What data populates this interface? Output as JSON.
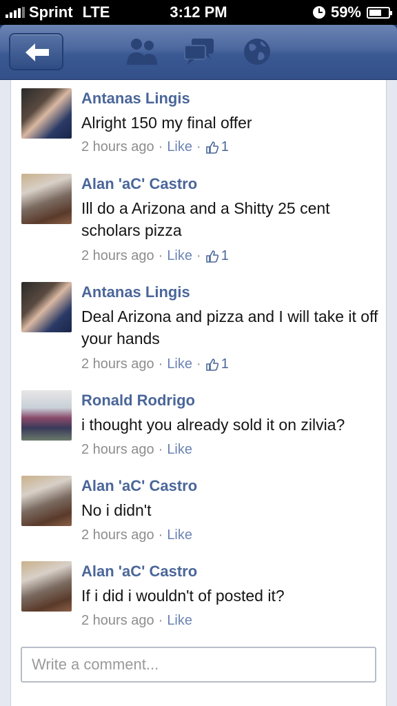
{
  "status_bar": {
    "carrier": "Sprint",
    "network": "LTE",
    "time": "3:12 PM",
    "battery": "59%",
    "icons": [
      "signal-bars-icon",
      "alarm-clock-icon",
      "battery-icon"
    ]
  },
  "nav_bar": {
    "icons": [
      "back-arrow-icon",
      "friends-icon",
      "messages-icon",
      "globe-icon"
    ]
  },
  "comments": [
    {
      "author": "Antanas Lingis",
      "text": "Alright 150 my final offer",
      "time": "2 hours ago",
      "like": "Like",
      "likes": "1"
    },
    {
      "author": "Alan 'aC' Castro",
      "text": "Ill do a Arizona and a Shitty 25 cent scholars pizza",
      "time": "2 hours ago",
      "like": "Like",
      "likes": "1"
    },
    {
      "author": "Antanas Lingis",
      "text": "Deal Arizona and pizza and I will take it off your hands",
      "time": "2 hours ago",
      "like": "Like",
      "likes": "1"
    },
    {
      "author": "Ronald Rodrigo",
      "text": "i thought you already sold it on zilvia?",
      "time": "2 hours ago",
      "like": "Like"
    },
    {
      "author": "Alan 'aC' Castro",
      "text": "No i didn't",
      "time": "2 hours ago",
      "like": "Like"
    },
    {
      "author": "Alan 'aC' Castro",
      "text": "If i did i wouldn't of posted it?",
      "time": "2 hours ago",
      "like": "Like"
    }
  ],
  "comment_input": {
    "placeholder": "Write a comment..."
  },
  "colors": {
    "nav_blue": "#3b5998",
    "author_blue": "#4a6699",
    "meta_gray": "#8d8d8d"
  }
}
